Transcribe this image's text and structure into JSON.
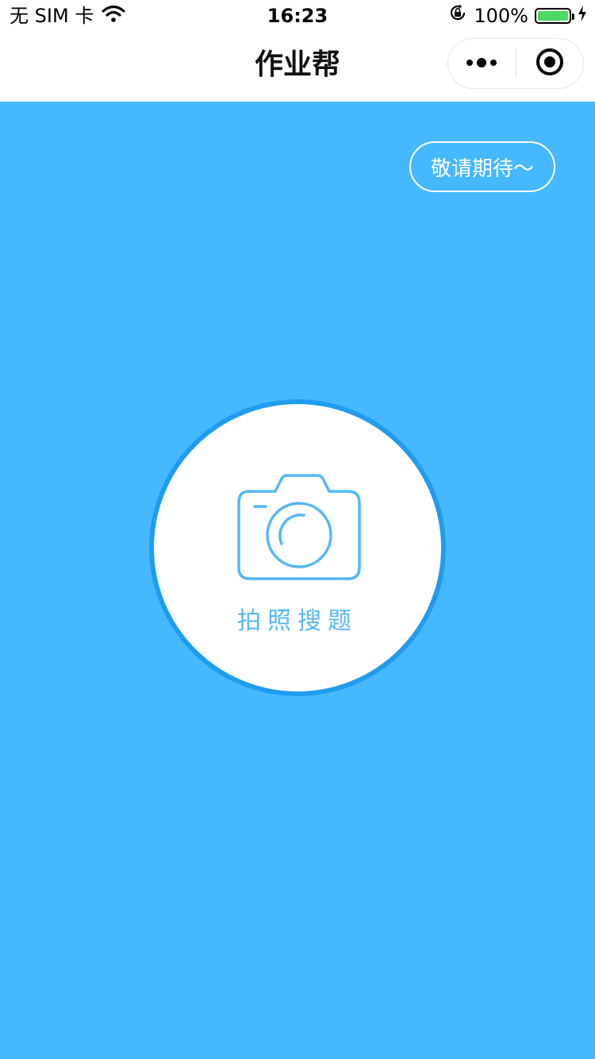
{
  "status_bar": {
    "carrier": "无 SIM 卡",
    "time": "16:23",
    "battery_percent": "100%",
    "battery_level": 1.0,
    "icons": [
      "wifi-icon",
      "orientation-lock-icon",
      "battery-icon",
      "charging-icon"
    ]
  },
  "nav": {
    "title": "作业帮",
    "menu_icon": "more-dots-icon",
    "close_icon": "target-circle-icon"
  },
  "main": {
    "coming_soon_label": "敬请期待～",
    "photo_search_label": "拍照搜题",
    "camera_icon": "camera-icon"
  },
  "colors": {
    "background_blue": "#45b8ff",
    "circle_border": "#1f9cf0",
    "camera_stroke": "#55b8f4",
    "battery_green": "#4cd964"
  }
}
